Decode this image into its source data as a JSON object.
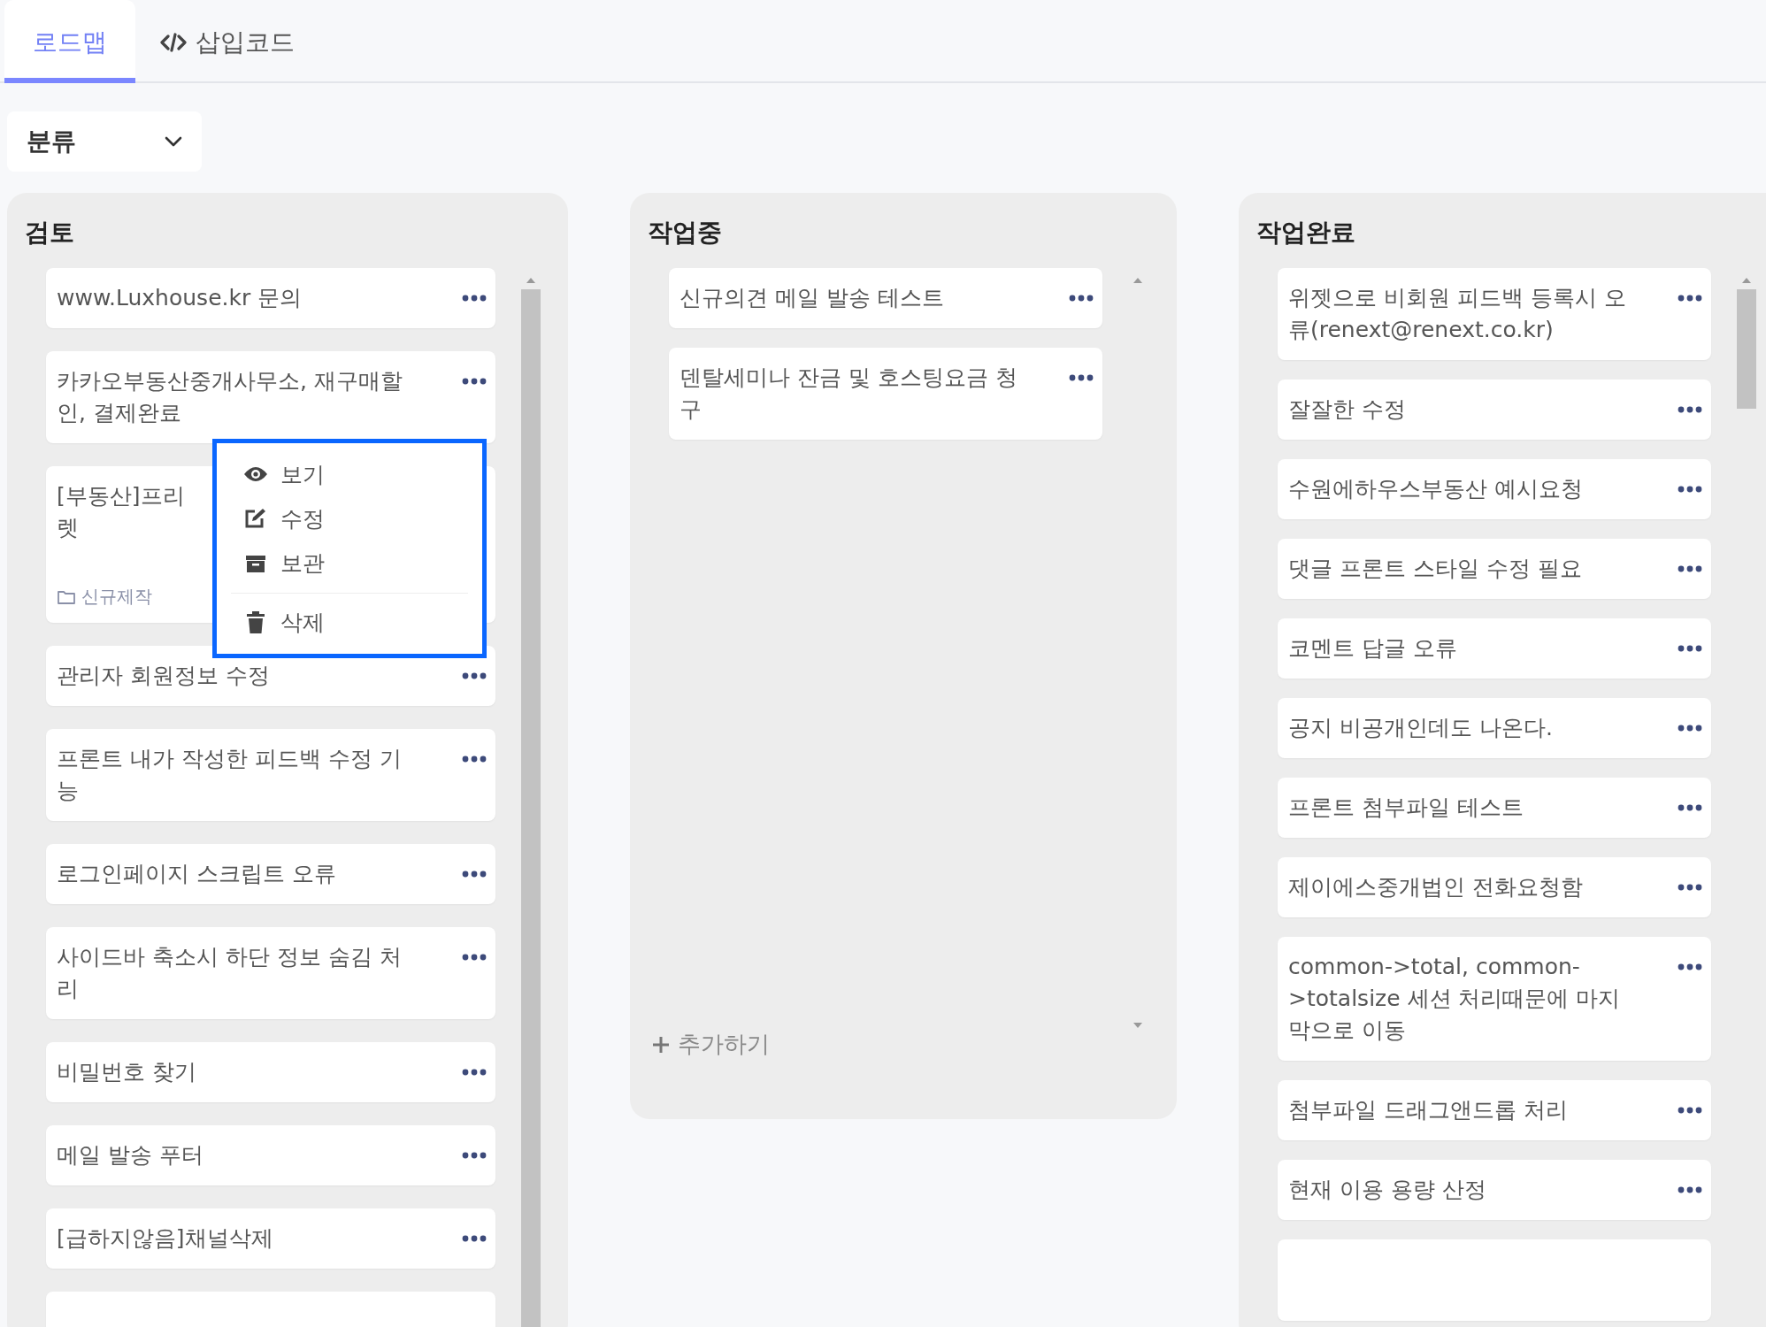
{
  "tabs": [
    {
      "label": "로드맵",
      "selected": true
    },
    {
      "label": "삽입코드",
      "selected": false
    }
  ],
  "filter": {
    "label": "분류"
  },
  "columns": [
    {
      "title": "검토",
      "cards": [
        {
          "kind": "task",
          "text": "www.Luxhouse.kr 문의"
        },
        {
          "kind": "task",
          "text": "카카오부동산중개사무소, 재구매할\n인, 결제완료"
        },
        {
          "kind": "task",
          "text": "[부동산]프리\n렛",
          "tag": "신규제작"
        },
        {
          "kind": "task",
          "text": "관리자 회원정보 수정"
        },
        {
          "kind": "task",
          "text": "프론트 내가 작성한 피드백 수정 기\n능"
        },
        {
          "kind": "task",
          "text": "로그인페이지 스크립트 오류"
        },
        {
          "kind": "task",
          "text": "사이드바 축소시 하단 정보 숨김 처\n리"
        },
        {
          "kind": "task",
          "text": "비밀번호 찾기"
        },
        {
          "kind": "task",
          "text": "메일 발송 푸터"
        },
        {
          "kind": "task",
          "text": "[급하지않음]채널삭제"
        },
        {
          "kind": "partial"
        }
      ],
      "menu": {
        "items": [
          {
            "label": "보기"
          },
          {
            "label": "수정"
          },
          {
            "label": "보관"
          },
          {
            "label": "삭제"
          }
        ]
      }
    },
    {
      "title": "작업중",
      "add_label": "추가하기",
      "cards": [
        {
          "kind": "task",
          "text": "신규의견 메일 발송 테스트"
        },
        {
          "kind": "task",
          "text": "덴탈세미나 잔금 및 호스팅요금 청\n구"
        }
      ]
    },
    {
      "title": "작업완료",
      "cards": [
        {
          "kind": "task",
          "text": "위젯으로 비회원 피드백 등록시 오\n류(renext@renext.co.kr)"
        },
        {
          "kind": "task",
          "text": "잘잘한 수정"
        },
        {
          "kind": "task",
          "text": "수원에하우스부동산 예시요청"
        },
        {
          "kind": "task",
          "text": "댓글 프론트 스타일 수정 필요"
        },
        {
          "kind": "task",
          "text": "코멘트 답글 오류"
        },
        {
          "kind": "task",
          "text": "공지 비공개인데도 나온다."
        },
        {
          "kind": "task",
          "text": "프론트 첨부파일 테스트"
        },
        {
          "kind": "task",
          "text": "제이에스중개법인 전화요청함"
        },
        {
          "kind": "task",
          "text": "common->total, common-\n>totalsize 세션 처리때문에 마지\n막으로 이동"
        },
        {
          "kind": "task",
          "text": "첨부파일 드래그앤드롭 처리"
        },
        {
          "kind": "task",
          "text": "현재 이용 용량 산정"
        },
        {
          "kind": "partial"
        }
      ]
    }
  ]
}
